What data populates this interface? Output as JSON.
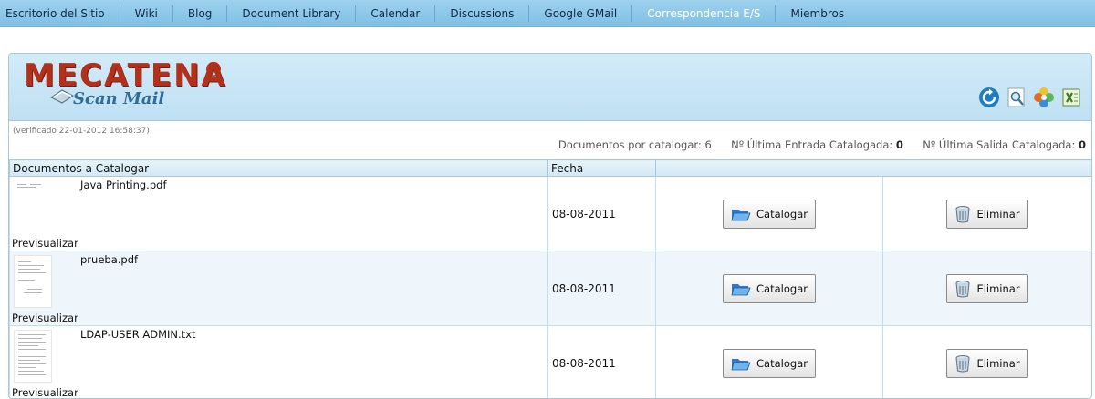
{
  "nav": {
    "items": [
      {
        "label": "Escritorio del Sitio",
        "active": false
      },
      {
        "label": "Wiki",
        "active": false
      },
      {
        "label": "Blog",
        "active": false
      },
      {
        "label": "Document Library",
        "active": false
      },
      {
        "label": "Calendar",
        "active": false
      },
      {
        "label": "Discussions",
        "active": false
      },
      {
        "label": "Google GMail",
        "active": false
      },
      {
        "label": "Correspondencia E/S",
        "active": true
      },
      {
        "label": "Miembros",
        "active": false
      }
    ]
  },
  "brand": {
    "name": "MECATENA",
    "registered": "®",
    "subtitle": "Scan Mail",
    "primary_color": "#b3311b",
    "secondary_color": "#2f6d97"
  },
  "tools": [
    {
      "icon": "refresh-icon"
    },
    {
      "icon": "search-icon"
    },
    {
      "icon": "color-wheel-icon"
    },
    {
      "icon": "excel-icon"
    }
  ],
  "info": {
    "verified": "(verificado 22-01-2012 16:58:37)",
    "pending_label": "Documentos por catalogar:",
    "pending_value": "6",
    "last_in_label": "Nº Última Entrada Catalogada:",
    "last_in_value": "0",
    "last_out_label": "Nº Última Salida Catalogada:",
    "last_out_value": "0"
  },
  "table": {
    "headers": [
      "Documentos a Catalogar",
      "Fecha",
      ""
    ],
    "preview_label": "Previsualizar",
    "catalog_label": "Catalogar",
    "delete_label": "Eliminar",
    "rows": [
      {
        "name": "Java Printing.pdf",
        "date": "08-08-2011"
      },
      {
        "name": "prueba.pdf",
        "date": "08-08-2011"
      },
      {
        "name": "LDAP-USER ADMIN.txt",
        "date": "08-08-2011"
      }
    ]
  }
}
